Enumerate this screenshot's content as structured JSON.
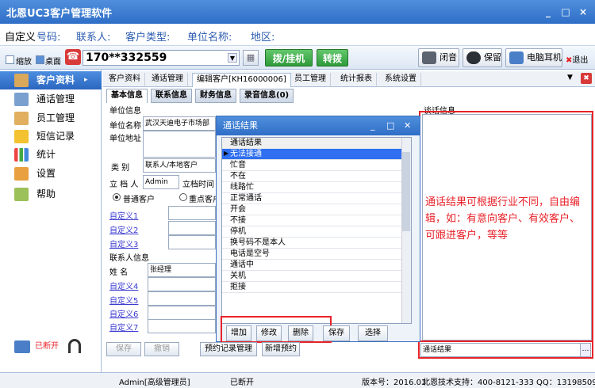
{
  "window": {
    "title": "北恩UC3客户管理软件",
    "min": "_",
    "max": "□",
    "close": "×"
  },
  "search": {
    "custom": "自定义",
    "number": "号码:",
    "contact": "联系人:",
    "type": "客户类型:",
    "company": "单位名称:",
    "region": "地区:"
  },
  "toolbar": {
    "mini": "缩放",
    "desktop": "桌面",
    "phone": "170**332559",
    "dial": "拨/挂机",
    "transfer": "转拨",
    "mute": "闭音",
    "hold": "保留",
    "headset": "电脑耳机",
    "exit": "退出"
  },
  "sidebar": {
    "items": [
      {
        "label": "客户资料",
        "icon": "customer-icon"
      },
      {
        "label": "通话管理",
        "icon": "call-icon"
      },
      {
        "label": "员工管理",
        "icon": "staff-icon"
      },
      {
        "label": "短信记录",
        "icon": "sms-icon"
      },
      {
        "label": "统计",
        "icon": "chart-icon"
      },
      {
        "label": "设置",
        "icon": "settings-icon"
      },
      {
        "label": "帮助",
        "icon": "help-icon"
      }
    ],
    "status": "已断开"
  },
  "tabs": [
    "客户资料",
    "通话管理",
    "编辑客户[KH16000006]",
    "员工管理",
    "统计报表",
    "系统设置"
  ],
  "subtabs": [
    "基本信息",
    "联系信息",
    "财务信息",
    "录音信息(0)"
  ],
  "form": {
    "unit_info": "单位信息",
    "unit_name_label": "单位名称",
    "unit_name": "武汉天迪电子市场部",
    "unit_addr_label": "单位地址",
    "category_label": "类  别",
    "category": "联系人/本地客户",
    "creator_label": "立 档 人",
    "creator": "Admin",
    "created_label": "立档时间",
    "normal": "普通客户",
    "key": "重点客户",
    "custom1": "自定义1",
    "custom2": "自定义2",
    "custom3": "自定义3",
    "contact_info": "联系人信息",
    "name_label": "姓  名",
    "name": "张经理",
    "custom4": "自定义4",
    "custom5": "自定义5",
    "custom6": "自定义6",
    "custom7": "自定义7",
    "talk_info": "谈话信息",
    "result_label": "通话结果"
  },
  "dialog": {
    "title": "通话结果",
    "column": "通话结果",
    "items": [
      "无法接通",
      "忙音",
      "不在",
      "线路忙",
      "正常通话",
      "开会",
      "不接",
      "停机",
      "换号码不是本人",
      "电话是空号",
      "通话中",
      "关机",
      "拒接"
    ],
    "add": "增加",
    "edit": "修改",
    "delete": "删除",
    "save": "保存",
    "select": "选择"
  },
  "note": "通话结果可根据行业不同，自由编辑，如：有意向客户、有效客户、可跟进客户，等等",
  "bottom": {
    "save": "保存",
    "cancel": "撤销",
    "appt": "预约记录管理",
    "new_appt": "新增预约"
  },
  "statusbar": {
    "user": "Admin[高级管理员]",
    "conn": "已断开",
    "version": "版本号：2016.03",
    "support": "北恩技术支持：400-8121-333 QQ：1319850974"
  },
  "colors": {
    "accent": "#2f6ec7",
    "highlight": "#e8232a",
    "green": "#2e9a3a"
  }
}
